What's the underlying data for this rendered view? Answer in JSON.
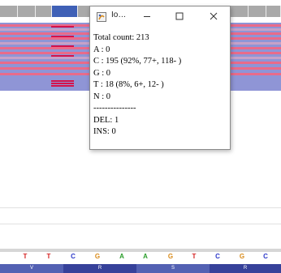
{
  "popup": {
    "title": "Io…",
    "lines": [
      "Total count: 213",
      "A : 0",
      "C : 195 (92%, 77+, 118- )",
      "G : 0",
      "T : 18 (8%, 6+, 12- )",
      "N : 0",
      "---------------",
      "DEL: 1",
      "INS: 0"
    ]
  },
  "reference": {
    "bases": [
      "T",
      "T",
      "C",
      "G",
      "A",
      "A",
      "G",
      "T",
      "C",
      "G",
      "C"
    ],
    "amino_acids": [
      "V",
      "R",
      "S",
      "R"
    ]
  },
  "colors": {
    "A": "#2a9d2a",
    "C": "#2a36c8",
    "G": "#d98b1a",
    "T": "#d42020",
    "reads": "#8f95d6",
    "mismatch": "#d4124b",
    "coverage_highlight": "#3f60b6"
  },
  "icons": [
    "app-icon",
    "minimize-icon",
    "maximize-icon",
    "close-icon"
  ]
}
